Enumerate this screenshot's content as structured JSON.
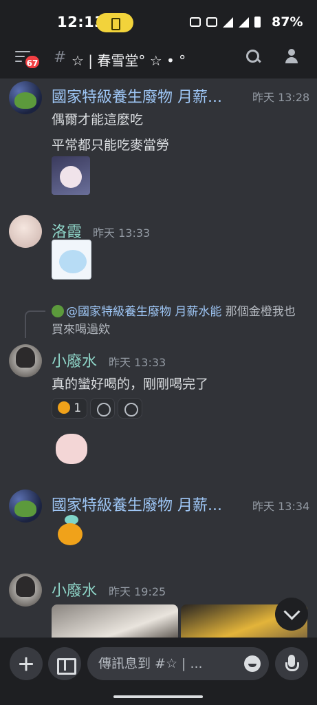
{
  "status_bar": {
    "time": "12:13",
    "battery_percent": "87%"
  },
  "header": {
    "unread_badge": "67",
    "channel_name": "☆ | 春雪堂° ☆ • °"
  },
  "messages": [
    {
      "author": "國家特級養生廢物 月薪...",
      "timestamp": "昨天 13:28",
      "lines": [
        "偶爾才能這麼吃",
        "平常都只能吃麥當勞"
      ]
    },
    {
      "author": "洛霞",
      "timestamp": "昨天 13:33"
    },
    {
      "reply_mention": "@國家特級養生廢物 月薪水能",
      "reply_text": " 那個金橙我也買來喝過欸",
      "author": "小廢水",
      "timestamp": "昨天 13:33",
      "lines": [
        "真的蠻好喝的，剛剛喝完了"
      ],
      "reaction_count": "1"
    },
    {
      "author": "國家特級養生廢物 月薪...",
      "timestamp": "昨天 13:34"
    },
    {
      "author": "小廢水",
      "timestamp": "昨天 19:25"
    }
  ],
  "composer": {
    "placeholder": "傳訊息到 #☆ | ..."
  },
  "colors": {
    "background": "#313338",
    "bar_background": "#1e1f22",
    "username_blue": "#9ec6f5",
    "username_teal": "#8fd6c9",
    "badge_red": "#f23f43"
  }
}
